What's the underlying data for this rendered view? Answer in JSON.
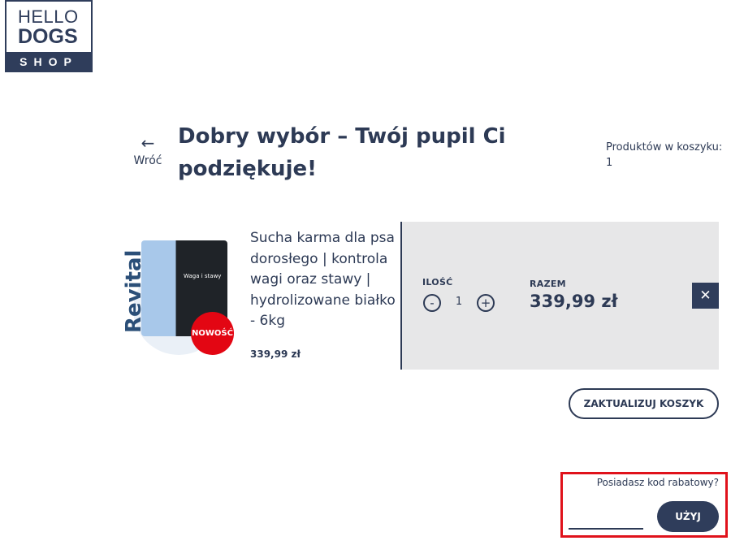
{
  "logo": {
    "line1": "HELLO",
    "line2": "DOGS",
    "line3": "SHOP"
  },
  "header": {
    "back_icon": "←",
    "back_label": "Wróć",
    "title": "Dobry wybór – Twój pupil Ci podziękuje!",
    "cart_count_label": "Produktów w koszyku:",
    "cart_count_value": "1"
  },
  "product": {
    "image_brand": "Revital",
    "image_tag": "Waga i stawy",
    "badge": "NOWOŚĆ",
    "name": "Sucha karma dla psa dorosłego | kontrola wagi oraz stawy | hydrolizowane białko - 6kg",
    "price": "339,99 zł"
  },
  "cart": {
    "qty_label": "ILOŚĆ",
    "qty_minus": "-",
    "qty_value": "1",
    "qty_plus": "+",
    "total_label": "RAZEM",
    "total_value": "339,99 zł",
    "remove_icon": "✕",
    "update_label": "ZAKTUALIZUJ KOSZYK"
  },
  "coupon": {
    "label": "Posiadasz kod rabatowy?",
    "input_value": "",
    "input_placeholder": "",
    "apply_label": "UŻYJ",
    "highlight_color": "#e0121b"
  },
  "colors": {
    "primary": "#2f3d5b",
    "panel": "#e7e7e8",
    "badge": "#e30613"
  }
}
